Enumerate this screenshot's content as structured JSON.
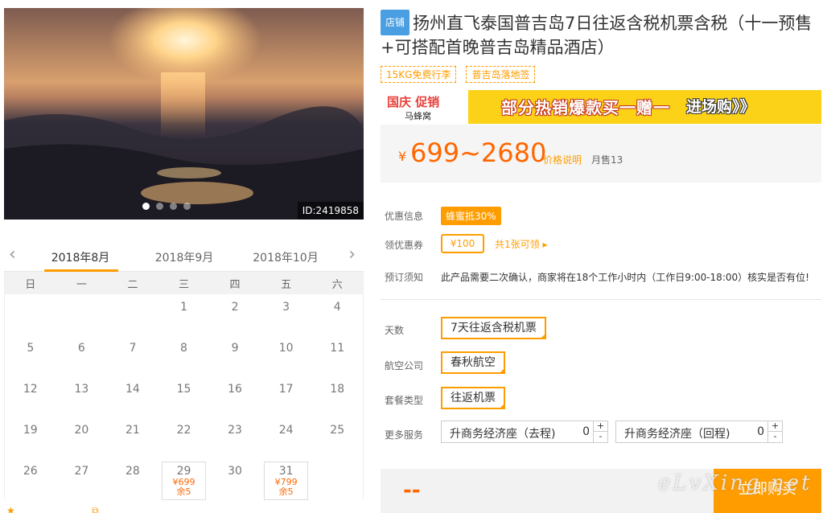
{
  "gallery": {
    "image_id": "ID:2419858",
    "dots": 4,
    "active_dot": 0
  },
  "calendar": {
    "prev_icon": "chevron-left-icon",
    "next_icon": "chevron-right-icon",
    "months": [
      "2018年8月",
      "2018年9月",
      "2018年10月"
    ],
    "active_month": 0,
    "weekdays": [
      "日",
      "一",
      "二",
      "三",
      "四",
      "五",
      "六"
    ],
    "leading_blanks": 3,
    "days": [
      "1",
      "2",
      "3",
      "4",
      "5",
      "6",
      "7",
      "8",
      "9",
      "10",
      "11",
      "12",
      "13",
      "14",
      "15",
      "16",
      "17",
      "18",
      "19",
      "20",
      "21",
      "22",
      "23",
      "24",
      "25",
      "26",
      "27",
      "28",
      "29",
      "30",
      "31"
    ],
    "available": {
      "29": {
        "price": "¥699",
        "left": "余5"
      },
      "31": {
        "price": "¥799",
        "left": "余5"
      }
    }
  },
  "product": {
    "shop_tag": "店铺",
    "title": "扬州直飞泰国普吉岛7日往返含税机票含税（十一预售+可搭配首晚普吉岛精品酒店）",
    "tags": [
      "15KG免费行李",
      "普吉岛落地签"
    ]
  },
  "banner": {
    "logo_text": "国庆 促销",
    "brand": "马蜂窝",
    "slogan": "部分热销爆款买一赠一",
    "cta": "进场购》》"
  },
  "price": {
    "currency": "¥",
    "range": "699~2680",
    "note": "价格说明",
    "sold": "月售13"
  },
  "info": {
    "discount_label": "优惠信息",
    "discount_badge": "蜂蜜抵30%",
    "coupon_label": "领优惠券",
    "coupon_value": "¥100",
    "coupon_link": "共1张可领 ▸",
    "notice_label": "预订须知",
    "notice_text": "此产品需要二次确认，商家将在18个工作小时内（工作日9:00-18:00）核实是否有位!"
  },
  "options": {
    "days_label": "天数",
    "days_value": "7天往返含税机票",
    "airline_label": "航空公司",
    "airline_value": "春秋航空",
    "package_label": "套餐类型",
    "package_value": "往返机票",
    "more_label": "更多服务",
    "services": [
      {
        "label": "升商务经济座（去程)",
        "count": "0"
      },
      {
        "label": "升商务经济座（回程)",
        "count": "0"
      }
    ],
    "plus": "+",
    "minus": "-"
  },
  "footer": {
    "total": "--",
    "buy": "立即购买",
    "watermark": "eLvXing.net"
  }
}
